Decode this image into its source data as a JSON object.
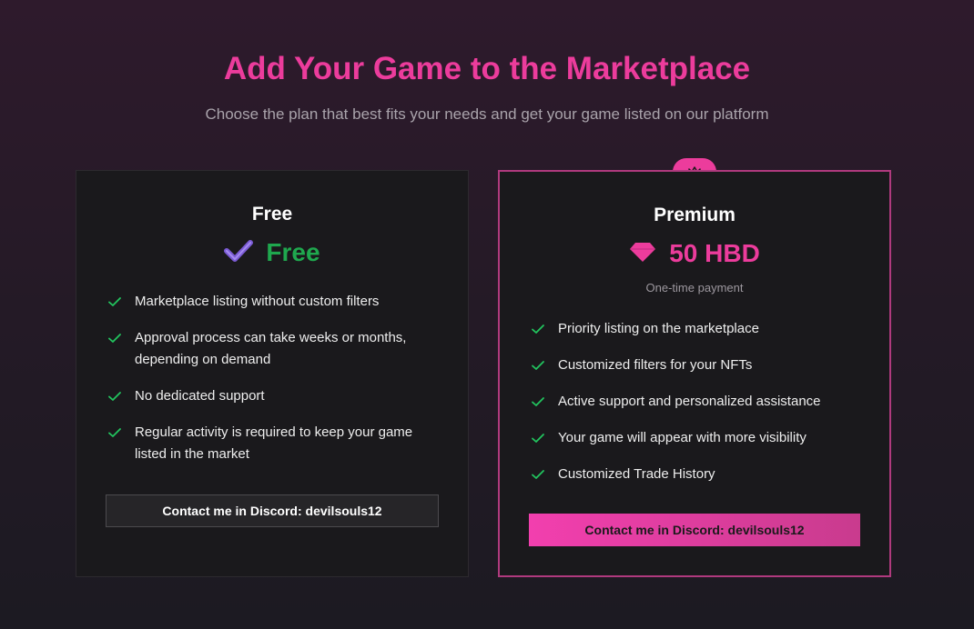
{
  "header": {
    "title": "Add Your Game to the Marketplace",
    "subtitle": "Choose the plan that best fits your needs and get your game listed on our platform"
  },
  "plans": {
    "free": {
      "name": "Free",
      "price": "Free",
      "icon": "checkmark-icon",
      "features": [
        "Marketplace listing without custom filters",
        "Approval process can take weeks or months, depending on demand",
        "No dedicated support",
        "Regular activity is required to keep your game listed in the market"
      ],
      "button_label": "Contact me in Discord: devilsouls12"
    },
    "premium": {
      "name": "Premium",
      "badge_icon": "crown-icon",
      "price": "50 HBD",
      "price_icon": "gem-icon",
      "payment_note": "One-time payment",
      "features": [
        "Priority listing on the marketplace",
        "Customized filters for your NFTs",
        "Active support and personalized assistance",
        "Your game will appear with more visibility",
        "Customized Trade History"
      ],
      "button_label": "Contact me in Discord: devilsouls12"
    }
  },
  "colors": {
    "accent_pink": "#ec3c9c",
    "free_green": "#1fa84e",
    "check_green": "#22c55e",
    "card_bg": "#1a191c"
  }
}
